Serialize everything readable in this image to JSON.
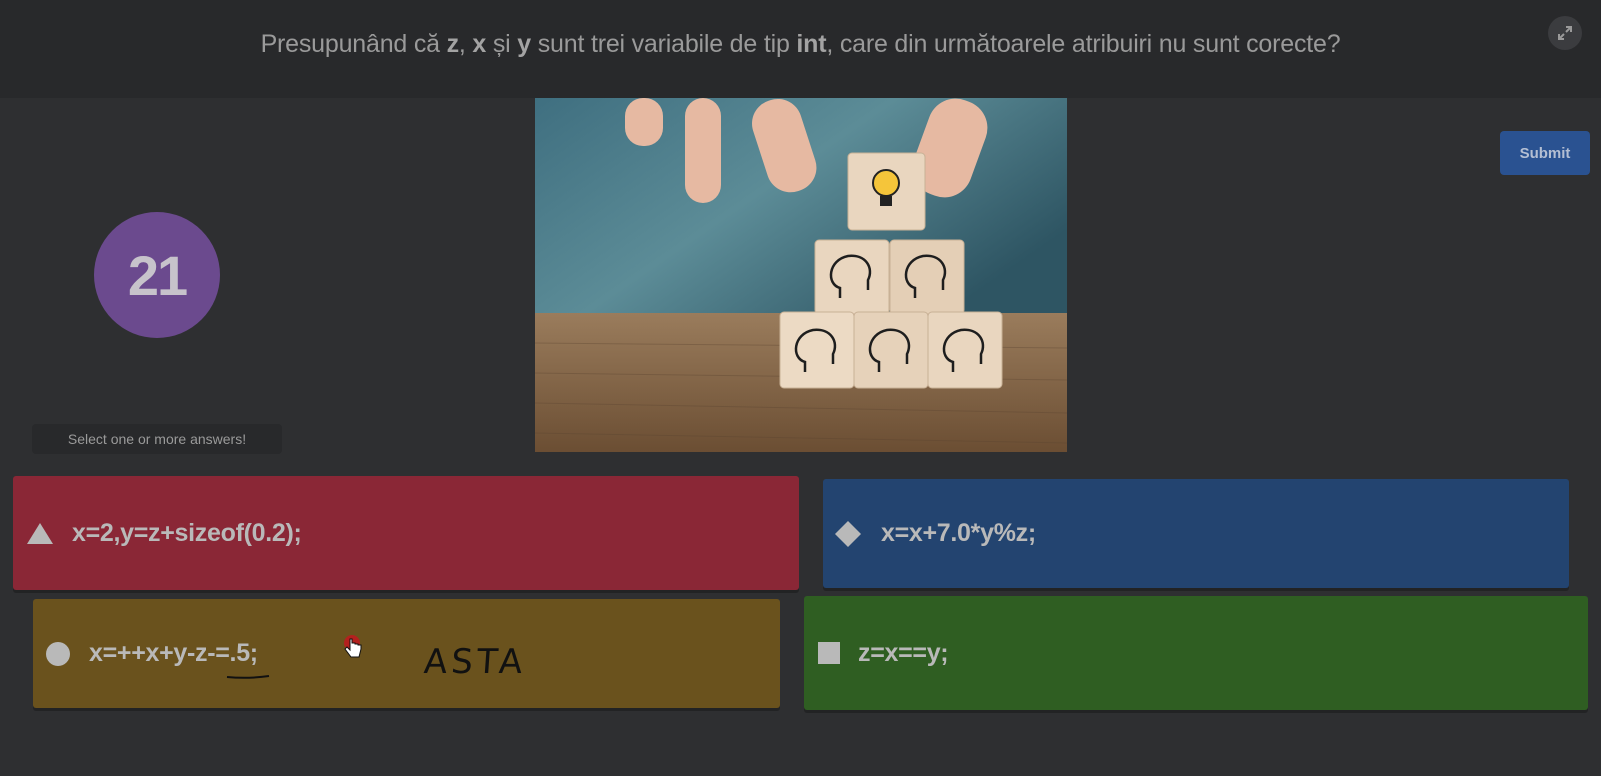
{
  "question": {
    "parts": [
      {
        "text": "Presupunând că ",
        "bold": false
      },
      {
        "text": "z",
        "bold": true
      },
      {
        "text": ", ",
        "bold": false
      },
      {
        "text": "x",
        "bold": true
      },
      {
        "text": " și ",
        "bold": false
      },
      {
        "text": "y",
        "bold": true
      },
      {
        "text": " sunt trei variabile de tip ",
        "bold": false
      },
      {
        "text": "int",
        "bold": true
      },
      {
        "text": ", care din următoarele atribuiri nu sunt corecte?",
        "bold": false
      }
    ]
  },
  "question_number": "21",
  "submit_label": "Submit",
  "hint": "Select one or more answers!",
  "answers": [
    {
      "shape": "triangle-icon",
      "text": "x=2,y=z+sizeof(0.2);",
      "color": "#8a2736"
    },
    {
      "shape": "diamond-icon",
      "text": "x=x+7.0*y%z;",
      "color": "#234470"
    },
    {
      "shape": "circle-icon",
      "text": "x=++x+y-z-=.5;",
      "color": "#6a521d"
    },
    {
      "shape": "square-icon",
      "text": "z=x==y;",
      "color": "#2f5e22"
    }
  ],
  "annotation_text": "ASTA",
  "colors": {
    "background": "#2e2f31",
    "topbar": "#28292b",
    "submit": "#2a5291",
    "question_badge": "#6b4a8e"
  }
}
